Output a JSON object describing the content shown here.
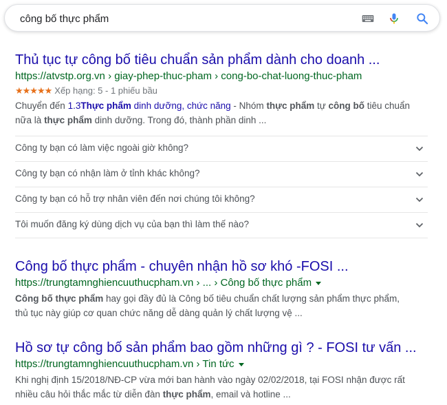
{
  "search": {
    "query": "công bố thực phẩm",
    "icons": [
      "keyboard-icon",
      "microphone-icon",
      "search-icon"
    ]
  },
  "results": [
    {
      "title": "Thủ tục tự công bố tiêu chuẩn sản phẩm dành cho doanh ...",
      "url": "https://atvstp.org.vn › giay-phep-thuc-pham › cong-bo-chat-luong-thuc-pham",
      "rating": {
        "stars": "★★★★★",
        "text": "Xếp hạng: 5 - 1 phiếu bầu",
        "value": 5,
        "votes": 1
      },
      "snippet_l1": {
        "a": "Chuyển đến ",
        "b": "1.3",
        "c": "Thực phẩm",
        "d": " dinh dưỡng, chức năng",
        "e": " - Nhóm ",
        "f": "thực phẩm",
        "g": " tự ",
        "h": "công bố",
        "i": " tiêu chuẩn"
      },
      "snippet_l2": {
        "a": "nữa là ",
        "b": "thực phẩm",
        "c": " dinh dưỡng. Trong đó, thành phần dinh ..."
      },
      "faq": [
        "Công ty bạn có làm việc ngoài giờ không?",
        "Công ty bạn có nhận làm ở tỉnh khác không?",
        "Công ty bạn có hỗ trợ nhân viên đến nơi chúng tôi không?",
        "Tôi muốn đăng ký dùng dịch vụ của bạn thì làm thế nào?"
      ]
    },
    {
      "title": "Công bố thực phẩm - chuyên nhận hồ sơ khó -FOSI ...",
      "url": "https://trungtamnghiencuuthucpham.vn › ... › Công bố thực phẩm",
      "snippet_l1": {
        "a": "Công bố thực phẩm",
        "b": " hay gọi đầy đủ là Công bố tiêu chuẩn chất lượng sản phẩm thực phẩm,"
      },
      "snippet_l2": {
        "a": "thủ tục này giúp cơ quan chức năng dễ dàng quản lý chất lượng vệ ..."
      }
    },
    {
      "title": "Hồ sơ tự công bố sản phẩm bao gồm những gì ? - FOSI tư vấn ...",
      "url": "https://trungtamnghiencuuthucpham.vn › Tin tức",
      "snippet_l1": {
        "a": "Khi nghị định 15/2018/NĐ-CP vừa mới ban hành vào ngày 02/02/2018, tại FOSI nhận được rất"
      },
      "snippet_l2": {
        "a": "nhiều câu hỏi thắc mắc từ diễn đàn ",
        "b": "thực phẩm",
        "c": ", email và hotline ..."
      }
    }
  ]
}
